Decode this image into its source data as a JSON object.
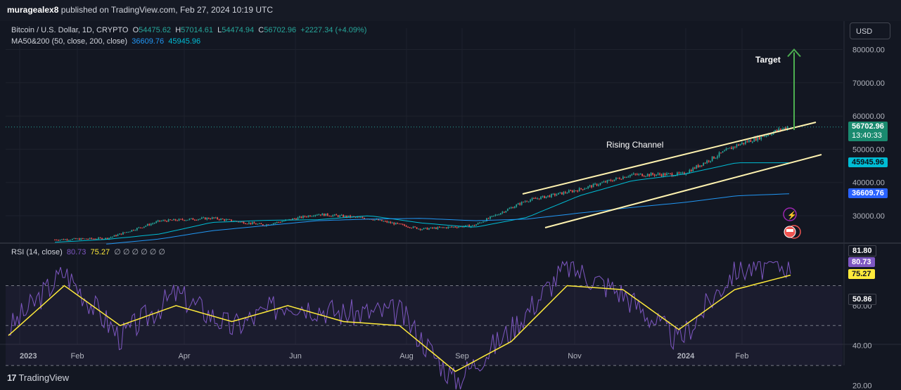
{
  "header": {
    "author": "muragealex8",
    "published_text": " published on TradingView.com, Feb 27, 2024 10:19 UTC"
  },
  "legend": {
    "symbol": "Bitcoin / U.S. Dollar, 1D, CRYPTO",
    "o_label": "O",
    "o_value": "54475.62",
    "h_label": "H",
    "h_value": "57014.61",
    "l_label": "L",
    "l_value": "54474.94",
    "c_label": "C",
    "c_value": "56702.96",
    "change": "+2227.34 (+4.09%)",
    "ma_label": "MA50&200 (50, close, 200, close)",
    "ma50_value": "36609.76",
    "ma200_value": "45945.96"
  },
  "rsi_legend": {
    "label": "RSI (14, close)",
    "rsi_value": "80.73",
    "ma_value": "75.27",
    "empties": "∅ ∅ ∅ ∅ ∅ ∅"
  },
  "currency_button": "USD",
  "price_tags": {
    "last": "56702.96",
    "countdown": "13:40:33",
    "ma_a": "45945.96",
    "ma_b": "36609.76"
  },
  "rsi_tags": {
    "high": "81.80",
    "rsi": "80.73",
    "ma": "75.27",
    "low": "50.86"
  },
  "annotations": {
    "channel": "Rising Channel",
    "target": "Target"
  },
  "footer": {
    "logo": "17",
    "brand": "TradingView"
  },
  "colors": {
    "background": "#131722",
    "up": "#26a69a",
    "down": "#ef5350",
    "channel": "#fff3b0",
    "target_arrow": "#4caf50",
    "ma_fast": "#2196f3",
    "ma_slow": "#00bcd4",
    "rsi_line": "#7e57c2",
    "rsi_ma": "#ffeb3b",
    "tag_last": "#1a8a6f",
    "tag_ma_a": "#00bcd4",
    "tag_ma_b": "#2962ff",
    "tag_rsi": "#7e57c2",
    "tag_rsi_ma": "#ffeb3b"
  },
  "chart_data": [
    {
      "type": "candlestick",
      "title": "Bitcoin / U.S. Dollar, 1D, CRYPTO",
      "ylim": [
        20000,
        85000
      ],
      "y_ticks": [
        "80000.00",
        "70000.00",
        "60000.00",
        "50000.00",
        "40000.00",
        "30000.00"
      ],
      "x_ticks": [
        "2023",
        "Feb",
        "Apr",
        "Jun",
        "Aug",
        "Sep",
        "Nov",
        "2024",
        "Feb"
      ],
      "x": [
        "2023-01",
        "2023-02",
        "2023-03",
        "2023-04",
        "2023-05",
        "2023-06",
        "2023-07",
        "2023-08",
        "2023-09",
        "2023-10",
        "2023-11",
        "2023-12",
        "2024-01",
        "2024-02",
        "2024-02-27"
      ],
      "close": [
        22800,
        23200,
        28400,
        29300,
        27200,
        30500,
        29200,
        26000,
        27000,
        34500,
        37800,
        42300,
        42500,
        51000,
        56702.96
      ],
      "series": [
        {
          "name": "MA 50",
          "values": [
            22000,
            22900,
            24500,
            28000,
            28600,
            28800,
            30000,
            27800,
            26500,
            29500,
            36000,
            40500,
            42500,
            45945.96,
            45945.96
          ]
        },
        {
          "name": "MA 200",
          "values": [
            null,
            21500,
            23000,
            25500,
            27000,
            28500,
            29000,
            29200,
            28500,
            29000,
            30800,
            32500,
            34000,
            36000,
            36609.76
          ]
        }
      ],
      "annotations": [
        "Rising Channel",
        "Target"
      ],
      "target_level": 80000,
      "last_price": 56702.96
    },
    {
      "type": "line",
      "title": "RSI (14, close)",
      "ylim": [
        15,
        85
      ],
      "y_ticks": [
        "60.00",
        "40.00",
        "20.00"
      ],
      "bands": [
        70,
        50,
        30
      ],
      "series": [
        {
          "name": "RSI",
          "values": [
            48,
            77,
            44,
            66,
            49,
            62,
            56,
            57,
            22,
            48,
            80,
            66,
            42,
            78,
            80.73
          ]
        },
        {
          "name": "MA",
          "values": [
            45,
            70,
            50,
            60,
            52,
            60,
            52,
            50,
            27,
            42,
            70,
            68,
            48,
            68,
            75.27
          ]
        }
      ]
    }
  ]
}
